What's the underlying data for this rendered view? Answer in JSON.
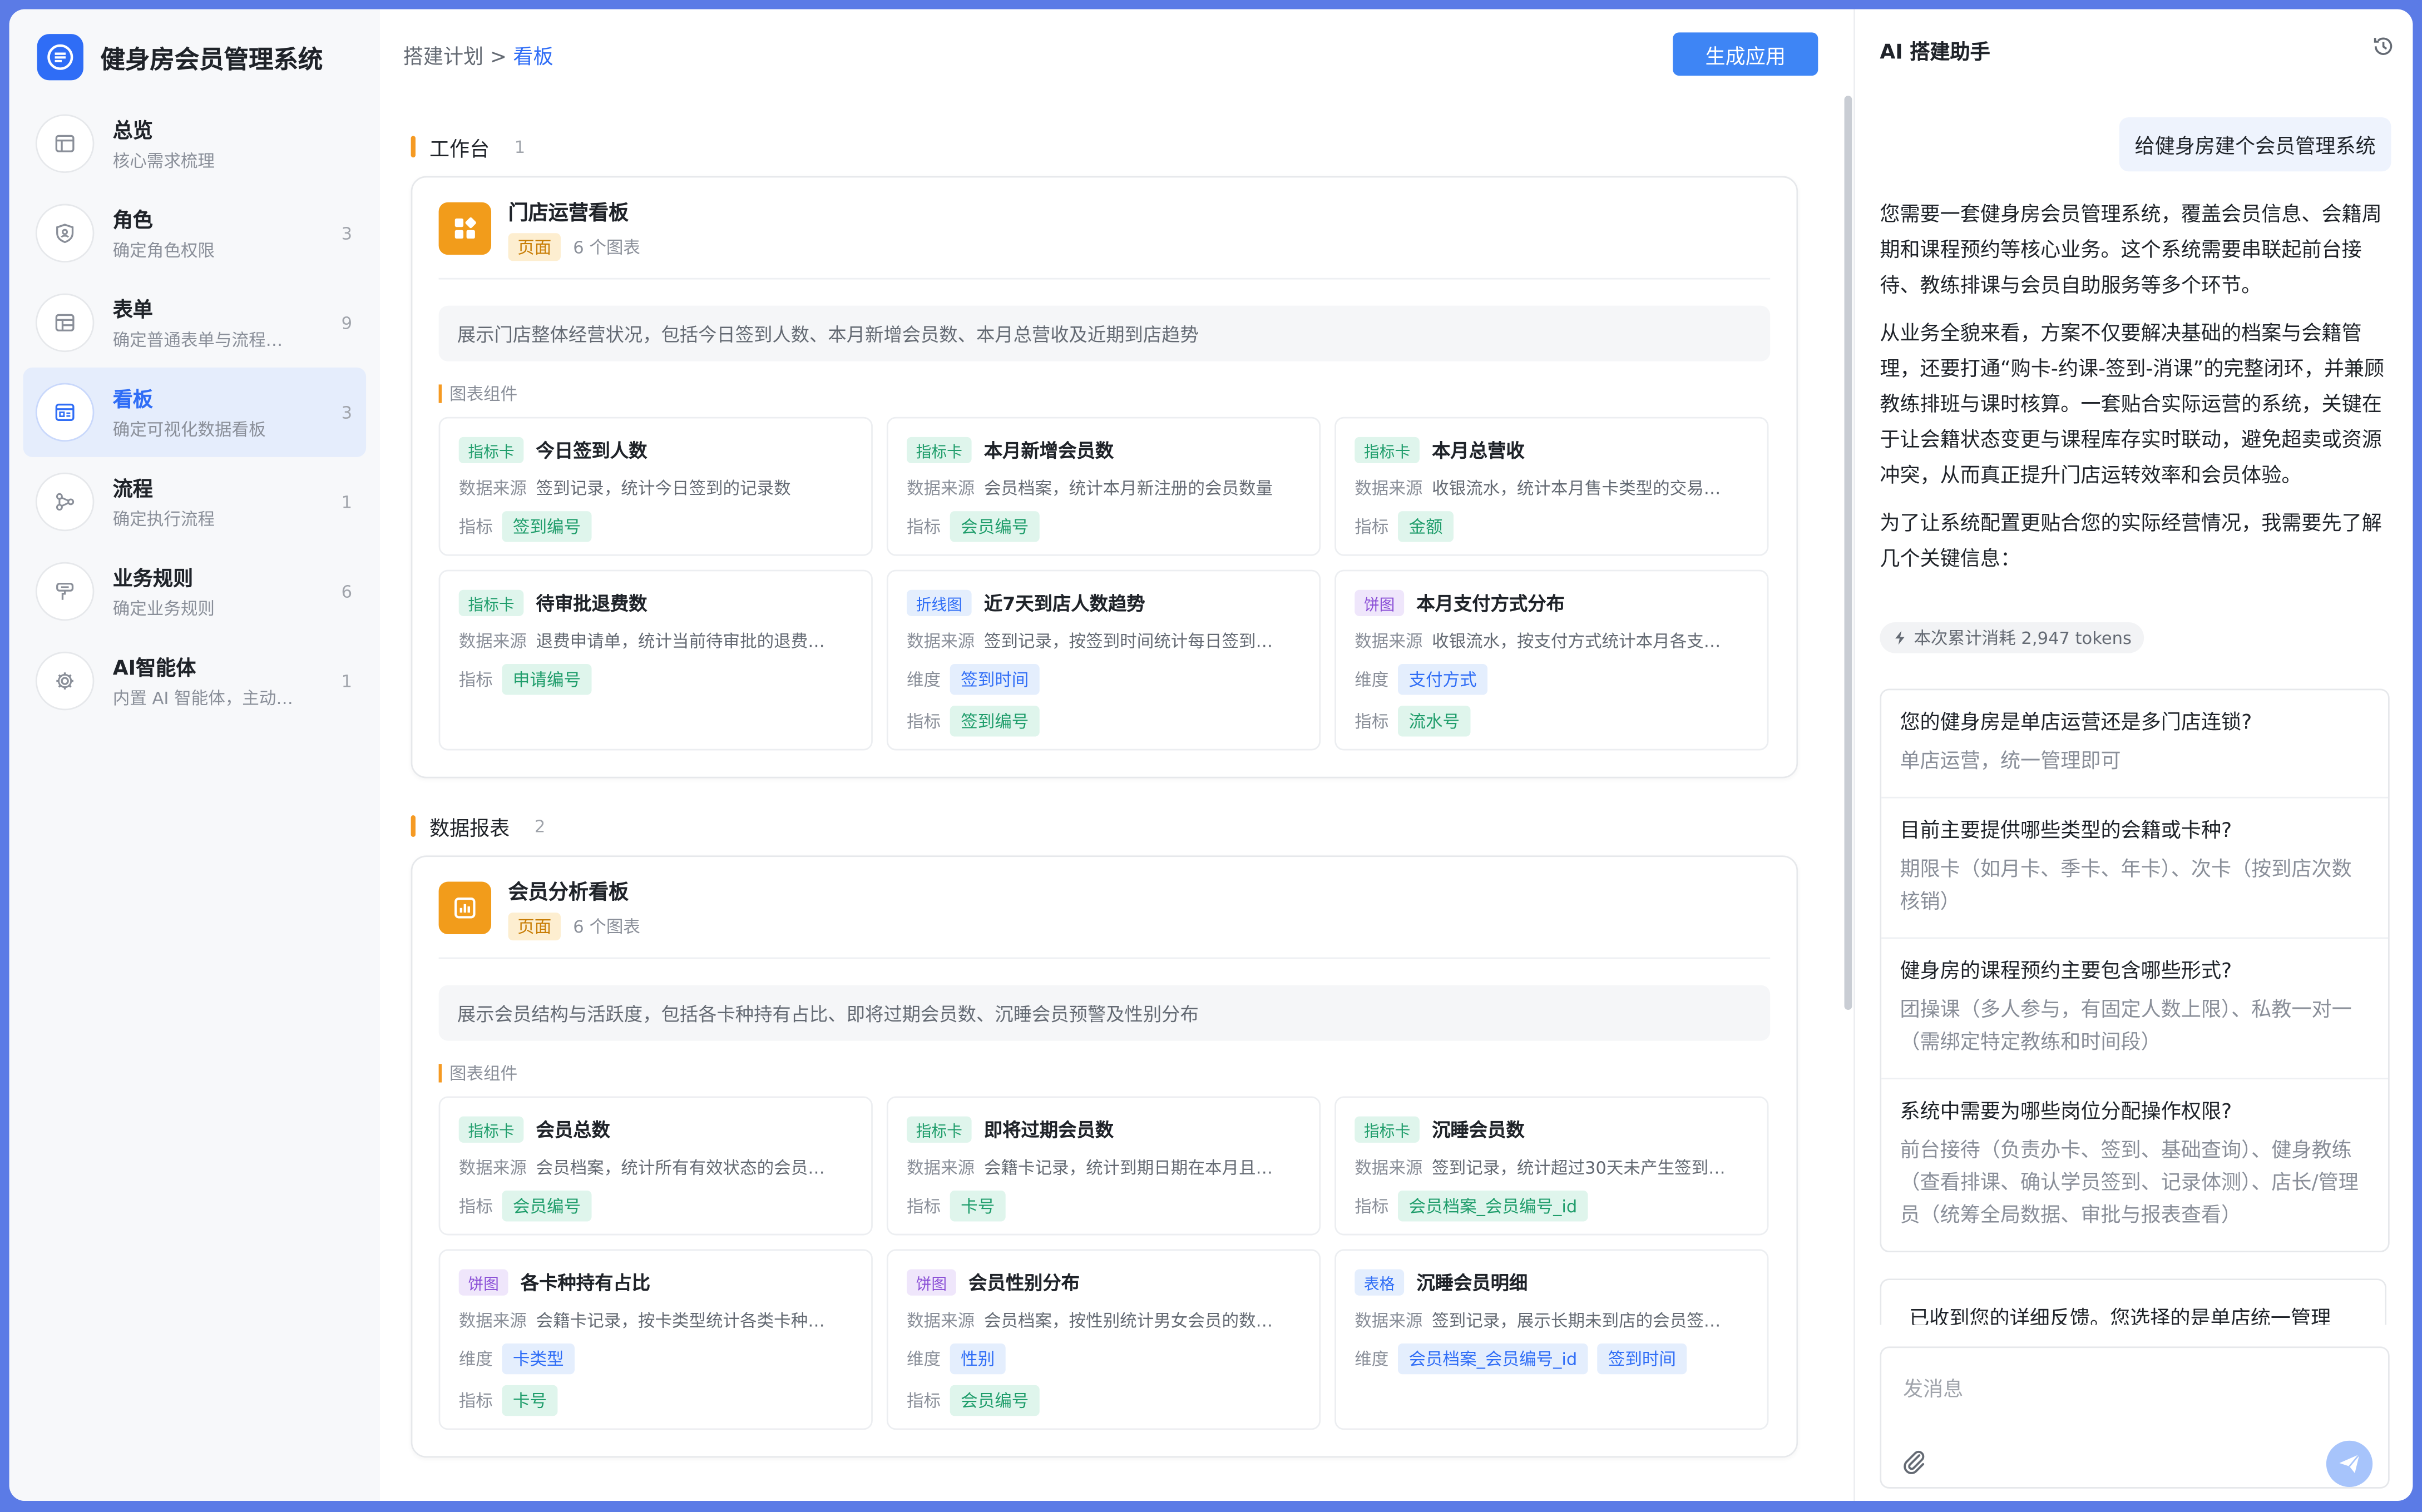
{
  "app": {
    "title": "健身房会员管理系统"
  },
  "sidebar": {
    "items": [
      {
        "title": "总览",
        "sub": "核心需求梳理",
        "count": ""
      },
      {
        "title": "角色",
        "sub": "确定角色权限",
        "count": "3"
      },
      {
        "title": "表单",
        "sub": "确定普通表单与流程…",
        "count": "9"
      },
      {
        "title": "看板",
        "sub": "确定可视化数据看板",
        "count": "3"
      },
      {
        "title": "流程",
        "sub": "确定执行流程",
        "count": "1"
      },
      {
        "title": "业务规则",
        "sub": "确定业务规则",
        "count": "6"
      },
      {
        "title": "AI智能体",
        "sub": "内置 AI 智能体，主动…",
        "count": "1"
      }
    ]
  },
  "header": {
    "breadcrumb_parent": "搭建计划 >",
    "breadcrumb_current": "看板",
    "generate_label": "生成应用"
  },
  "sections": [
    {
      "title": "工作台",
      "count": "1",
      "board": {
        "title": "门店运营看板",
        "tag": "页面",
        "charts": "6 个图表",
        "desc": "展示门店整体经营状况，包括今日签到人数、本月新增会员数、本月总营收及近期到店趋势",
        "comp_title": "图表组件",
        "cards": [
          {
            "type": "指标卡",
            "title": "今日签到人数",
            "src_label": "数据来源",
            "src": "签到记录，统计今日签到的记录数",
            "metric_label": "指标",
            "metrics": [
              "签到编号"
            ]
          },
          {
            "type": "指标卡",
            "title": "本月新增会员数",
            "src_label": "数据来源",
            "src": "会员档案，统计本月新注册的会员数量",
            "metric_label": "指标",
            "metrics": [
              "会员编号"
            ]
          },
          {
            "type": "指标卡",
            "title": "本月总营收",
            "src_label": "数据来源",
            "src": "收银流水，统计本月售卡类型的交易…",
            "metric_label": "指标",
            "metrics": [
              "金额"
            ]
          },
          {
            "type": "指标卡",
            "title": "待审批退费数",
            "src_label": "数据来源",
            "src": "退费申请单，统计当前待审批的退费…",
            "metric_label": "指标",
            "metrics": [
              "申请编号"
            ]
          },
          {
            "type": "折线图",
            "title": "近7天到店人数趋势",
            "src_label": "数据来源",
            "src": "签到记录，按签到时间统计每日签到…",
            "dim_label": "维度",
            "dims": [
              "签到时间"
            ],
            "metric_label": "指标",
            "metrics": [
              "签到编号"
            ]
          },
          {
            "type": "饼图",
            "title": "本月支付方式分布",
            "src_label": "数据来源",
            "src": "收银流水，按支付方式统计本月各支…",
            "dim_label": "维度",
            "dims": [
              "支付方式"
            ],
            "metric_label": "指标",
            "metrics": [
              "流水号"
            ]
          }
        ]
      }
    },
    {
      "title": "数据报表",
      "count": "2",
      "board": {
        "title": "会员分析看板",
        "tag": "页面",
        "charts": "6 个图表",
        "desc": "展示会员结构与活跃度，包括各卡种持有占比、即将过期会员数、沉睡会员预警及性别分布",
        "comp_title": "图表组件",
        "cards": [
          {
            "type": "指标卡",
            "title": "会员总数",
            "src_label": "数据来源",
            "src": "会员档案，统计所有有效状态的会员…",
            "metric_label": "指标",
            "metrics": [
              "会员编号"
            ]
          },
          {
            "type": "指标卡",
            "title": "即将过期会员数",
            "src_label": "数据来源",
            "src": "会籍卡记录，统计到期日期在本月且…",
            "metric_label": "指标",
            "metrics": [
              "卡号"
            ]
          },
          {
            "type": "指标卡",
            "title": "沉睡会员数",
            "src_label": "数据来源",
            "src": "签到记录，统计超过30天未产生签到…",
            "metric_label": "指标",
            "metrics": [
              "会员档案_会员编号_id"
            ]
          },
          {
            "type": "饼图",
            "title": "各卡种持有占比",
            "src_label": "数据来源",
            "src": "会籍卡记录，按卡类型统计各类卡种…",
            "dim_label": "维度",
            "dims": [
              "卡类型"
            ],
            "metric_label": "指标",
            "metrics": [
              "卡号"
            ]
          },
          {
            "type": "饼图",
            "title": "会员性别分布",
            "src_label": "数据来源",
            "src": "会员档案，按性别统计男女会员的数…",
            "dim_label": "维度",
            "dims": [
              "性别"
            ],
            "metric_label": "指标",
            "metrics": [
              "会员编号"
            ]
          },
          {
            "type": "表格",
            "title": "沉睡会员明细",
            "src_label": "数据来源",
            "src": "签到记录，展示长期未到店的会员签…",
            "dim_label": "维度",
            "dims": [
              "会员档案_会员编号_id",
              "签到时间"
            ]
          }
        ]
      }
    }
  ],
  "panel": {
    "title": "AI 搭建助手",
    "user_msg": "给健身房建个会员管理系统",
    "ai_paragraphs": [
      "您需要一套健身房会员管理系统，覆盖会员信息、会籍周期和课程预约等核心业务。这个系统需要串联起前台接待、教练排课与会员自助服务等多个环节。",
      "从业务全貌来看，方案不仅要解决基础的档案与会籍管理，还要打通“购卡-约课-签到-消课”的完整闭环，并兼顾教练排班与课时核算。一套贴合实际运营的系统，关键在于让会籍状态变更与课程库存实时联动，避免超卖或资源冲突，从而真正提升门店运转效率和会员体验。",
      "为了让系统配置更贴合您的实际经营情况，我需要先了解几个关键信息："
    ],
    "tokens": "本次累计消耗 2,947 tokens",
    "qa": [
      {
        "q": "您的健身房是单店运营还是多门店连锁?",
        "a": "单店运营，统一管理即可"
      },
      {
        "q": "目前主要提供哪些类型的会籍或卡种?",
        "a": "期限卡（如月卡、季卡、年卡）、次卡（按到店次数核销）"
      },
      {
        "q": "健身房的课程预约主要包含哪些形式?",
        "a": "团操课（多人参与，有固定人数上限）、私教一对一（需绑定特定教练和时间段）"
      },
      {
        "q": "系统中需要为哪些岗位分配操作权限?",
        "a": "前台接待（负责办卡、签到、基础查询）、健身教练（查看排课、确认学员签到、记录体测）、店长/管理员（统筹全局数据、审批与报表查看）"
      }
    ],
    "reply": "已收到您的详细反馈。您选择的是单店统一管理",
    "input_placeholder": "发消息"
  }
}
